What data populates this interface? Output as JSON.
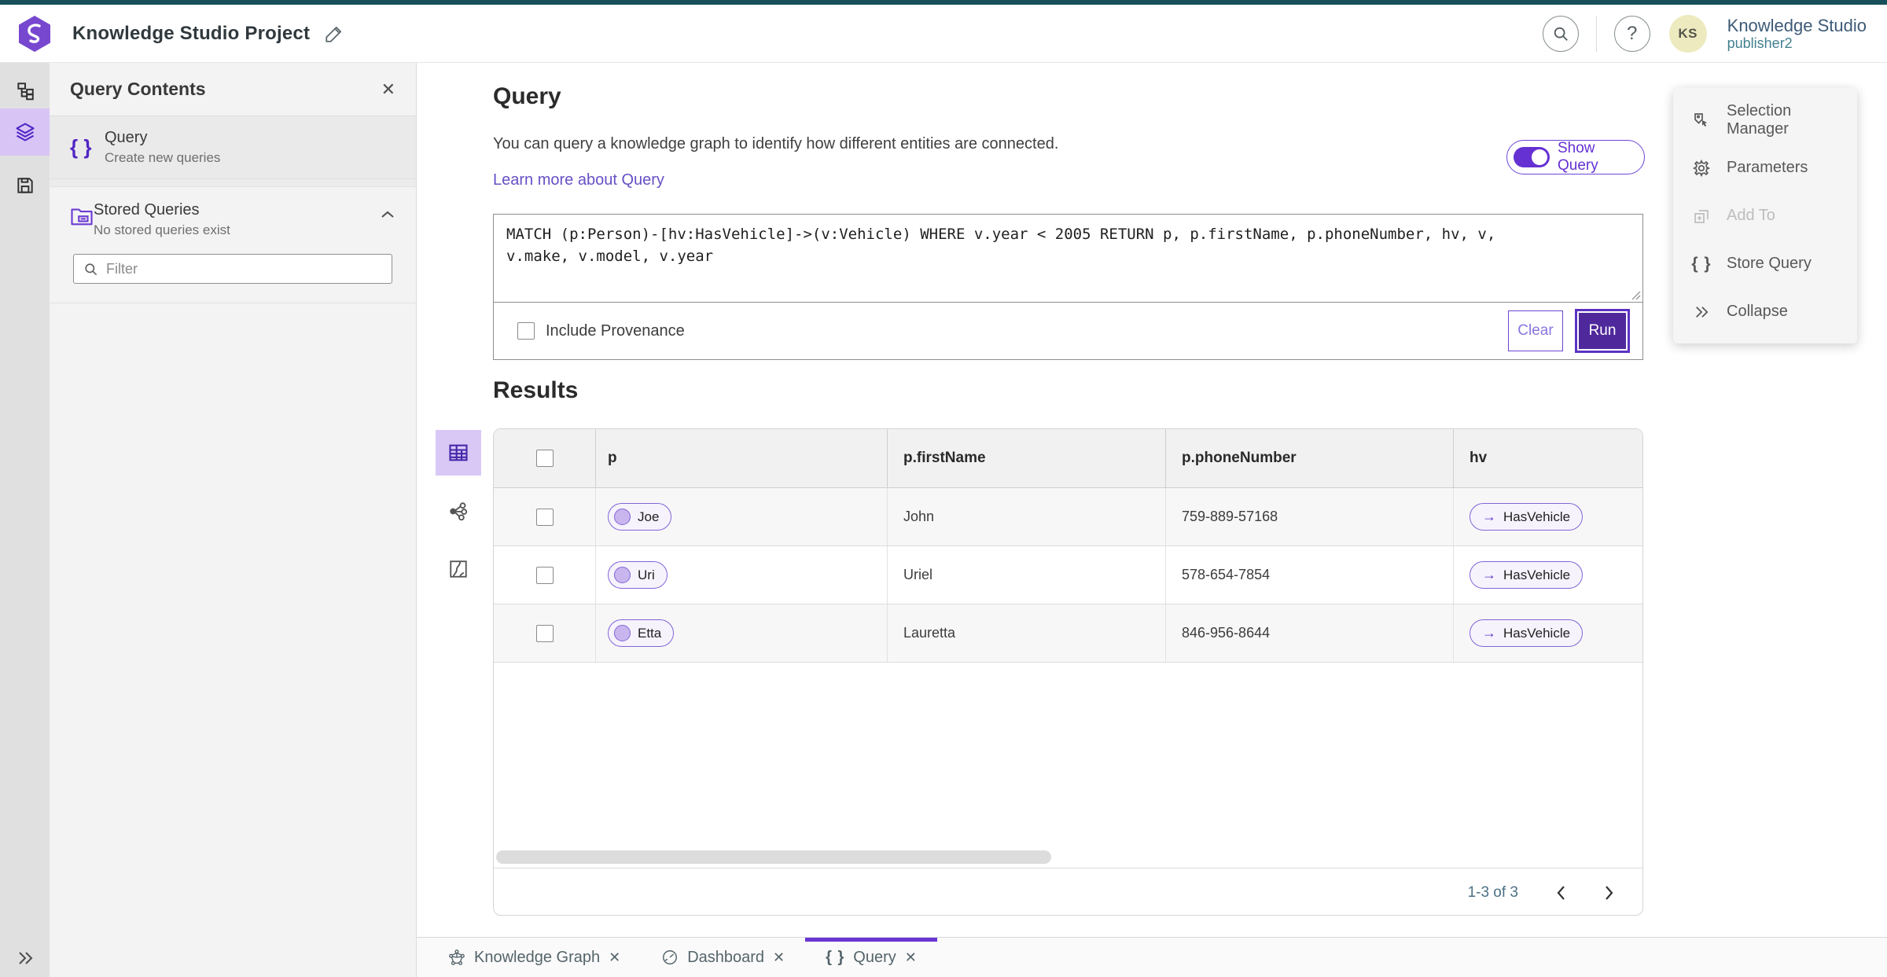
{
  "topbar": {
    "title": "Knowledge Studio Project",
    "user_name": "Knowledge Studio",
    "user_role": "publisher2",
    "avatar_initials": "KS",
    "help_glyph": "?"
  },
  "panel": {
    "title": "Query Contents",
    "close_glyph": "✕",
    "query_item": {
      "icon_glyph": "{ }",
      "label": "Query",
      "subtitle": "Create new queries"
    },
    "stored_queries": {
      "label": "Stored Queries",
      "subtitle": "No stored queries exist"
    },
    "filter_placeholder": "Filter"
  },
  "query_section": {
    "heading": "Query",
    "description": "You can query a knowledge graph to identify how different entities are connected.",
    "learn_more_label": "Learn more about Query",
    "show_query_label": "Show Query",
    "query_text": "MATCH (p:Person)-[hv:HasVehicle]->(v:Vehicle) WHERE v.year < 2005 RETURN p, p.firstName, p.phoneNumber, hv, v,\nv.make, v.model, v.year",
    "include_provenance_label": "Include Provenance",
    "clear_label": "Clear",
    "run_label": "Run"
  },
  "results": {
    "heading": "Results",
    "columns": [
      "p",
      "p.firstName",
      "p.phoneNumber",
      "hv"
    ],
    "rows": [
      {
        "entity": "Joe",
        "first_name": "John",
        "phone_number": "759-889-57168",
        "relation_arrow": "→",
        "relation": "HasVehicle"
      },
      {
        "entity": "Uri",
        "first_name": "Uriel",
        "phone_number": "578-654-7854",
        "relation_arrow": "→",
        "relation": "HasVehicle"
      },
      {
        "entity": "Etta",
        "first_name": "Lauretta",
        "phone_number": "846-956-8644",
        "relation_arrow": "→",
        "relation": "HasVehicle"
      }
    ],
    "pagination": {
      "range_label": "1-3 of 3"
    }
  },
  "side_menu": {
    "items": [
      {
        "label": "Selection Manager"
      },
      {
        "label": "Parameters"
      },
      {
        "label": "Add To"
      },
      {
        "label": "Store Query",
        "icon_glyph": "{ }"
      },
      {
        "label": "Collapse"
      }
    ]
  },
  "tabs": [
    {
      "label": "Knowledge Graph",
      "close_glyph": "✕"
    },
    {
      "label": "Dashboard",
      "close_glyph": "✕"
    },
    {
      "label": "Query",
      "icon_glyph": "{ }",
      "close_glyph": "✕"
    }
  ],
  "colors": {
    "topbar_teal": "#17505a",
    "accent_purple": "#6531d2",
    "run_button_purple": "#4f289c",
    "selected_lavender": "#d8c5f6",
    "pill_background": "#f6f3fd",
    "link_purple": "#6750c6"
  },
  "icons": {
    "edit-icon": "pencil",
    "search-icon": "magnifier",
    "help-icon": "?",
    "content-map-icon": "org-tree",
    "layers-icon": "stacked-layers",
    "save-icon": "floppy-disk",
    "braces-icon": "{ }",
    "folder-icon": "stored-folder",
    "chevron-up-icon": "chevron-up",
    "table-view-icon": "grid-table",
    "graph-view-icon": "network-nodes",
    "chart-view-icon": "chart-square",
    "arrow-right-icon": "→",
    "selection-manager-icon": "tag-cursor",
    "gear-icon": "gear",
    "add-to-icon": "box-plus",
    "collapse-icon": "double-chevron-right",
    "expand-icon": "double-chevron-right",
    "prev-icon": "chevron-left",
    "next-icon": "chevron-right",
    "knowledge-graph-icon": "pentagon-network",
    "dashboard-icon": "gauge"
  }
}
